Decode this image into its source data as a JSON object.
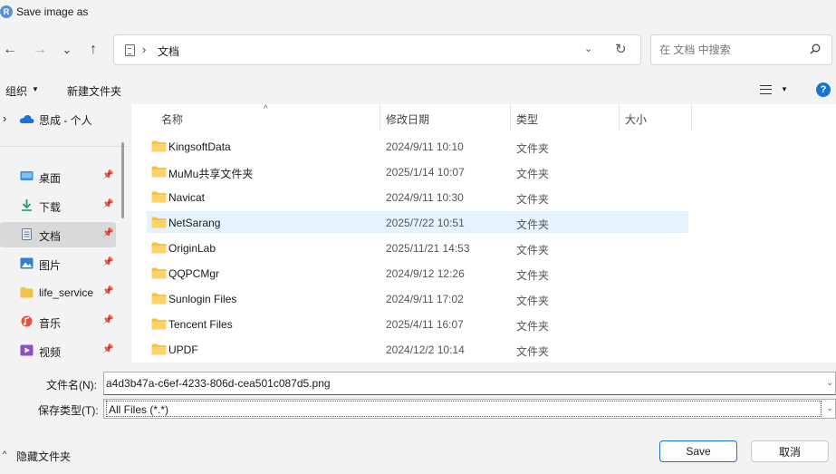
{
  "window": {
    "title": "Save image as",
    "app_icon_letter": "R"
  },
  "nav": {
    "back": "←",
    "forward": "→",
    "recent": "⌄",
    "up": "↑"
  },
  "address": {
    "chevron": "›",
    "location": "文档",
    "dropdown": "⌄",
    "refresh": "↻"
  },
  "search": {
    "placeholder": "在 文档 中搜索"
  },
  "toolbar": {
    "organize": "组织",
    "organize_caret": "▼",
    "new_folder": "新建文件夹",
    "view_caret": "▼",
    "help": "?"
  },
  "sidebar": {
    "top_item": {
      "expand": "›",
      "label": "思成 - 个人",
      "icon": "onedrive-cloud-icon"
    },
    "items": [
      {
        "label": "桌面",
        "icon": "desktop-icon",
        "pinned": true,
        "selected": false
      },
      {
        "label": "下载",
        "icon": "download-icon",
        "pinned": true,
        "selected": false
      },
      {
        "label": "文档",
        "icon": "document-icon",
        "pinned": true,
        "selected": true
      },
      {
        "label": "图片",
        "icon": "picture-icon",
        "pinned": true,
        "selected": false
      },
      {
        "label": "life_service",
        "icon": "folder-icon",
        "pinned": true,
        "selected": false
      },
      {
        "label": "音乐",
        "icon": "music-icon",
        "pinned": true,
        "selected": false
      },
      {
        "label": "视频",
        "icon": "video-icon",
        "pinned": true,
        "selected": false
      }
    ],
    "pin_glyph": "📌"
  },
  "columns": {
    "name": "名称",
    "modified": "修改日期",
    "type": "类型",
    "size": "大小",
    "sort_indicator": "^"
  },
  "files": [
    {
      "name": "KingsoftData",
      "modified": "2024/9/11 10:10",
      "type": "文件夹"
    },
    {
      "name": "MuMu共享文件夹",
      "modified": "2025/1/14 10:07",
      "type": "文件夹"
    },
    {
      "name": "Navicat",
      "modified": "2024/9/11 10:30",
      "type": "文件夹"
    },
    {
      "name": "NetSarang",
      "modified": "2025/7/22 10:51",
      "type": "文件夹"
    },
    {
      "name": "OriginLab",
      "modified": "2025/11/21 14:53",
      "type": "文件夹"
    },
    {
      "name": "QQPCMgr",
      "modified": "2024/9/12 12:26",
      "type": "文件夹"
    },
    {
      "name": "Sunlogin Files",
      "modified": "2024/9/11 17:02",
      "type": "文件夹"
    },
    {
      "name": "Tencent Files",
      "modified": "2025/4/11 16:07",
      "type": "文件夹"
    },
    {
      "name": "UPDF",
      "modified": "2024/12/2 10:14",
      "type": "文件夹"
    }
  ],
  "highlighted_row": "NetSarang",
  "save_form": {
    "filename_label": "文件名(N):",
    "filename_value": "a4d3b47a-c6ef-4233-806d-cea501c087d5.png",
    "filetype_label": "保存类型(T):",
    "filetype_value": "All Files (*.*)",
    "dropdown": "⌄"
  },
  "footer": {
    "hide_folders": "隐藏文件夹",
    "hide_caret": "^",
    "save": "Save",
    "cancel": "取消"
  },
  "colors": {
    "accent": "#1a73d0",
    "folder": "#f5c242",
    "row_highlight": "#e5f3ff",
    "sidebar_selected": "#d9d9d9"
  }
}
